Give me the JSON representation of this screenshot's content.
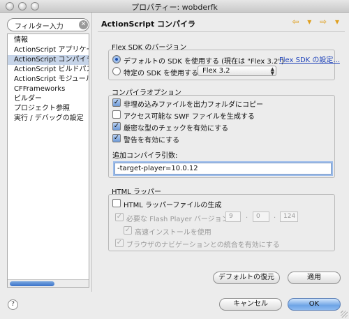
{
  "window": {
    "title": "プロパティー: wobderfk"
  },
  "sidebar": {
    "filter_placeholder": "フィルター入力",
    "items": [
      {
        "label": "情報"
      },
      {
        "label": "ActionScript アプリケー"
      },
      {
        "label": "ActionScript コンパイラ"
      },
      {
        "label": "ActionScript ビルドパス"
      },
      {
        "label": "ActionScript モジュール"
      },
      {
        "label": "CFFrameworks"
      },
      {
        "label": "ビルダー"
      },
      {
        "label": "プロジェクト参照"
      },
      {
        "label": "実行 / デバッグの設定"
      }
    ],
    "selected_index": 2
  },
  "page": {
    "title": "ActionScript コンパイラ",
    "nav_arrows": "⇦ ▾ ⇨ ▾"
  },
  "flex_sdk": {
    "group_title": "Flex SDK のバージョン",
    "default_option": "デフォルトの SDK を使用する (現在は \"Flex 3.2\")",
    "specific_option": "特定の SDK を使用する:",
    "selected_sdk": "Flex 3.2",
    "settings_link": "Flex SDK の設定..."
  },
  "compiler_options": {
    "group_title": "コンパイラオプション",
    "options": [
      {
        "label": "非埋め込みファイルを出力フォルダにコピー",
        "checked": true
      },
      {
        "label": "アクセス可能な SWF ファイルを生成する",
        "checked": false
      },
      {
        "label": "厳密な型のチェックを有効にする",
        "checked": true
      },
      {
        "label": "警告を有効にする",
        "checked": true
      }
    ],
    "additional_args_label": "追加コンパイラ引数:",
    "additional_args_value": "-target-player=10.0.12"
  },
  "html_wrapper": {
    "group_title": "HTML ラッパー",
    "generate_label": "HTML ラッパーファイルの生成",
    "generate_checked": false,
    "player_version_label": "必要な Flash Player バージョン：",
    "version_major": "9",
    "version_minor": "0",
    "version_revision": "124",
    "express_install_label": "高速インストールを使用",
    "browser_nav_label": "ブラウザのナビゲーションとの統合を有効にする"
  },
  "buttons": {
    "restore_defaults": "デフォルトの復元",
    "apply": "適用",
    "cancel": "キャンセル",
    "ok": "OK",
    "help": "?"
  }
}
